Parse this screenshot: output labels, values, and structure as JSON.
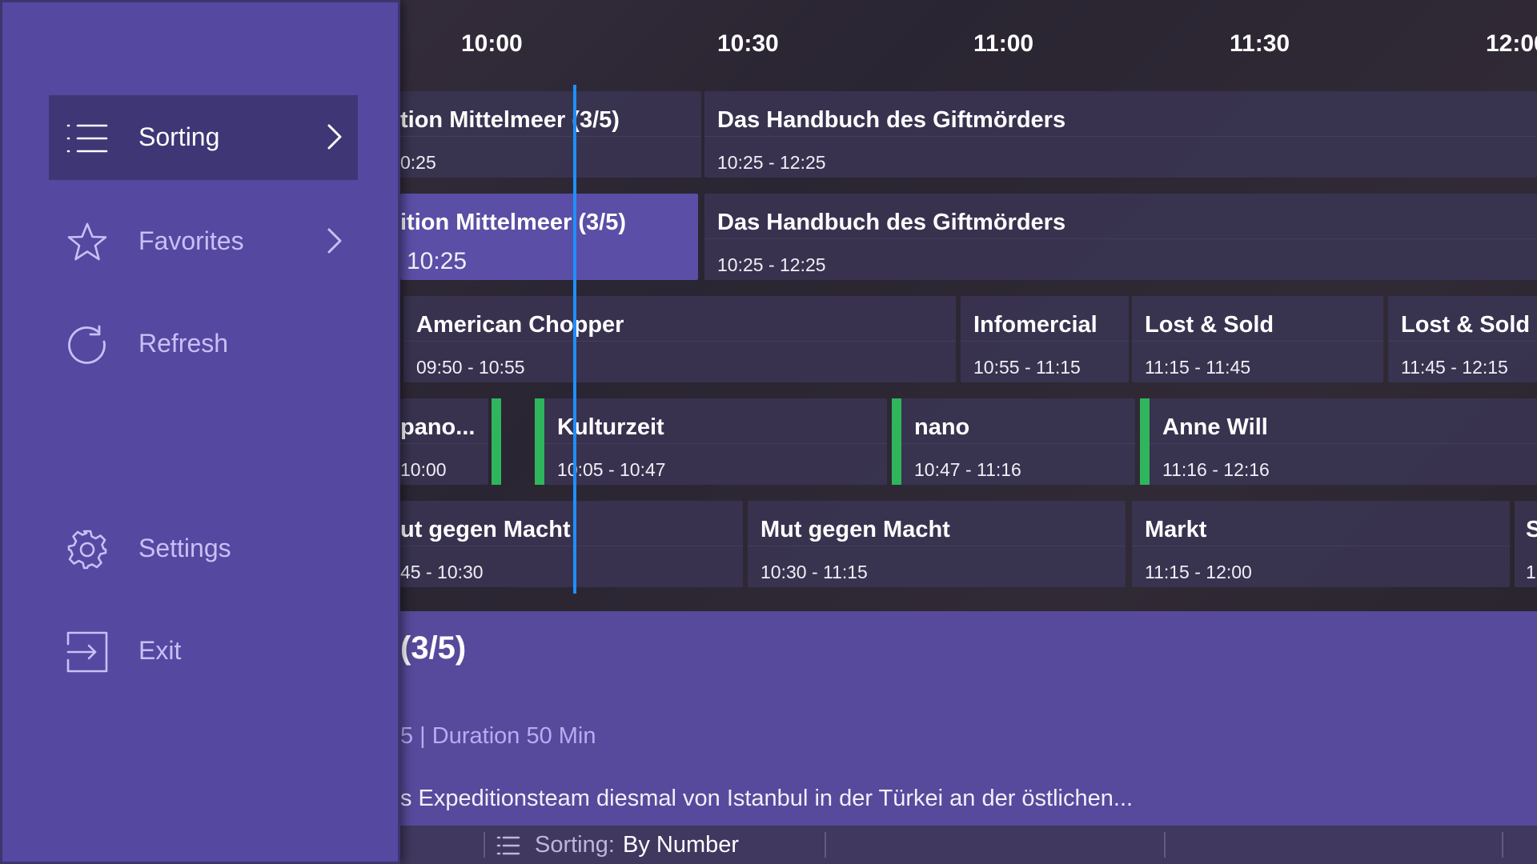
{
  "timeline": [
    "10:00",
    "10:30",
    "11:00",
    "11:30",
    "12:00"
  ],
  "rows": [
    [
      {
        "title": "tion Mittelmeer (3/5)",
        "time": "0:25"
      },
      {
        "title": "Das Handbuch des Giftmörders",
        "time": "10:25 - 12:25"
      }
    ],
    [
      {
        "title": "ition Mittelmeer (3/5)",
        "time": "10:25",
        "selected": true
      },
      {
        "title": "Das Handbuch des Giftmörders",
        "time": "10:25 - 12:25"
      }
    ],
    [
      {
        "title": "American Chopper",
        "time": "09:50 - 10:55"
      },
      {
        "title": "Infomercial",
        "time": "10:55 - 11:15"
      },
      {
        "title": "Lost & Sold",
        "time": "11:15 - 11:45"
      },
      {
        "title": "Lost & Sold",
        "time": "11:45 - 12:15"
      }
    ],
    [
      {
        "title": "pano...",
        "time": "10:00"
      },
      {
        "title": "Kulturzeit",
        "time": "10:05 - 10:47"
      },
      {
        "title": "nano",
        "time": "10:47 - 11:16"
      },
      {
        "title": "Anne Will",
        "time": "11:16 - 12:16"
      }
    ],
    [
      {
        "title": "ut gegen Macht",
        "time": "45 - 10:30"
      },
      {
        "title": "Mut gegen Macht",
        "time": "10:30 - 11:15"
      },
      {
        "title": "Markt",
        "time": "11:15 - 12:00"
      },
      {
        "title": "S",
        "time": "1"
      }
    ]
  ],
  "detail": {
    "title": "(3/5)",
    "meta": "5  |  Duration 50 Min",
    "description": "s Expeditionsteam diesmal von Istanbul in der Türkei an der östlichen..."
  },
  "status": {
    "sorting_label": "Sorting:",
    "sorting_value": "By Number"
  },
  "menu": {
    "items": [
      {
        "label": "Sorting",
        "icon": "list-icon",
        "active": true,
        "submenu": true
      },
      {
        "label": "Favorites",
        "icon": "star-icon",
        "active": false,
        "submenu": true
      },
      {
        "label": "Refresh",
        "icon": "refresh-icon",
        "active": false,
        "submenu": false
      },
      {
        "label": "Settings",
        "icon": "gear-icon",
        "active": false,
        "submenu": false
      },
      {
        "label": "Exit",
        "icon": "exit-icon",
        "active": false,
        "submenu": false
      }
    ]
  },
  "colors": {
    "menu_bg": "#5548a0",
    "menu_active": "#3f3675",
    "selected_cell": "#5a4ea6",
    "now_line": "#1e90ff",
    "green_marker": "#2fb55c",
    "detail_bg": "#574a9c"
  }
}
